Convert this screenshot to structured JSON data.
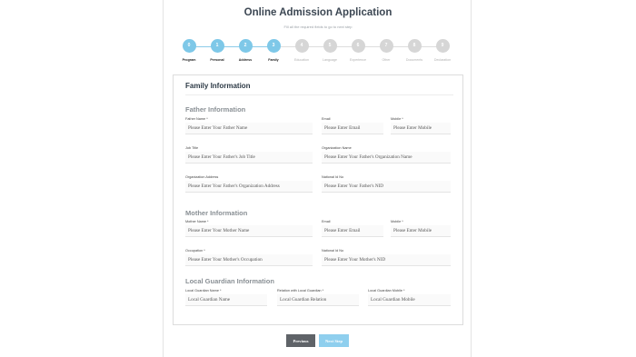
{
  "header": {
    "title": "Online Admission Application",
    "subtitle": "Fill all the required fields to go to next step"
  },
  "steps": [
    {
      "number": "0",
      "label": "Program",
      "done": true
    },
    {
      "number": "1",
      "label": "Personal",
      "done": true
    },
    {
      "number": "2",
      "label": "Address",
      "done": true
    },
    {
      "number": "3",
      "label": "Family",
      "done": true
    },
    {
      "number": "4",
      "label": "Education",
      "done": false
    },
    {
      "number": "5",
      "label": "Language",
      "done": false
    },
    {
      "number": "6",
      "label": "Experience",
      "done": false
    },
    {
      "number": "7",
      "label": "Other",
      "done": false
    },
    {
      "number": "8",
      "label": "Documents",
      "done": false
    },
    {
      "number": "9",
      "label": "Declaration",
      "done": false
    }
  ],
  "form": {
    "title": "Family Information",
    "father": {
      "section_title": "Father Information",
      "name": {
        "label": "Father Name *",
        "placeholder": "Please Enter Your Father Name"
      },
      "email": {
        "label": "Email",
        "placeholder": "Please Enter Email"
      },
      "mobile": {
        "label": "Mobile *",
        "placeholder": "Please Enter Mobile"
      },
      "job_title": {
        "label": "Job Title",
        "placeholder": "Please Enter Your Father's Job Title"
      },
      "org_name": {
        "label": "Organization Name",
        "placeholder": "Please Enter Your Father's Organization Name"
      },
      "org_address": {
        "label": "Organization Address",
        "placeholder": "Please Enter Your Father's Organization Address"
      },
      "nid": {
        "label": "National Id No",
        "placeholder": "Please Enter Your Father's NID"
      }
    },
    "mother": {
      "section_title": "Mother Information",
      "name": {
        "label": "Mother Name *",
        "placeholder": "Please Enter Your Mother Name"
      },
      "email": {
        "label": "Email",
        "placeholder": "Please Enter Email"
      },
      "mobile": {
        "label": "Mobile *",
        "placeholder": "Please Enter Mobile"
      },
      "occupation": {
        "label": "Occupation *",
        "placeholder": "Please Enter Your Mother's Occupation"
      },
      "nid": {
        "label": "National Id No",
        "placeholder": "Please Enter Your Mother's NID"
      }
    },
    "guardian": {
      "section_title": "Local Guardian Information",
      "name": {
        "label": "Local Guardian Name *",
        "placeholder": "Local Guardian Name"
      },
      "relation": {
        "label": "Relation with Local Guardian *",
        "placeholder": "Local Guardian Relation"
      },
      "mobile": {
        "label": "Local Guardian Mobile *",
        "placeholder": "Local Guardian Mobile"
      }
    }
  },
  "buttons": {
    "previous": "Previous",
    "next": "Next Step"
  },
  "colors": {
    "step_done": "#7ec8e8",
    "step_pending": "#d6d6d6",
    "previous_button": "#5f6368",
    "next_button": "#8fcfee"
  }
}
